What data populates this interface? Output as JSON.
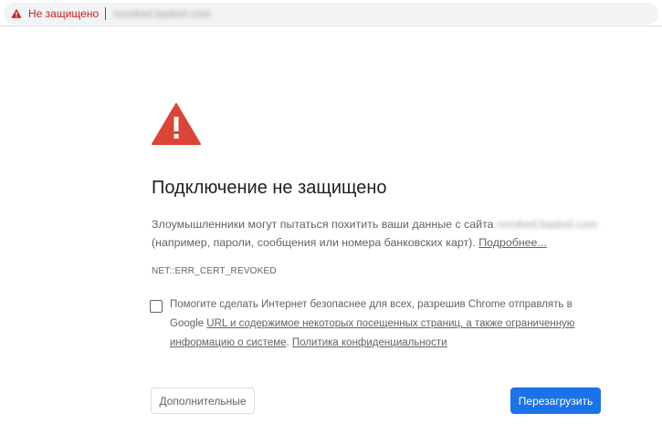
{
  "omnibox": {
    "security_label": "Не защищено",
    "url": "revoked.badssl.com"
  },
  "interstitial": {
    "headline": "Подключение не защищено",
    "explanation_before": "Злоумышленники могут пытаться похитить ваши данные с сайта ",
    "host": "revoked.badssl.com",
    "explanation_after": " (например, пароли, сообщения или номера банковских карт). ",
    "details_link": "Подробнее...",
    "error_code": "NET::ERR_CERT_REVOKED"
  },
  "extended_reporting": {
    "text_before": "Помогите сделать Интернет безопаснее для всех, разрешив Chrome отправлять в Google ",
    "link_url": "URL и содержимое некоторых посещенных страниц, а также ограниченную информацию о системе",
    "text_between": ". ",
    "link_privacy": "Политика конфиденциальности"
  },
  "buttons": {
    "advanced": "Дополнительные",
    "reload": "Перезагрузить"
  },
  "colors": {
    "danger": "#db4437",
    "primary": "#1a73e8",
    "not_secure_text": "#c5221f"
  },
  "icons": {
    "omnibox_warning": "warning-triangle-icon",
    "page_warning": "warning-triangle-icon"
  }
}
